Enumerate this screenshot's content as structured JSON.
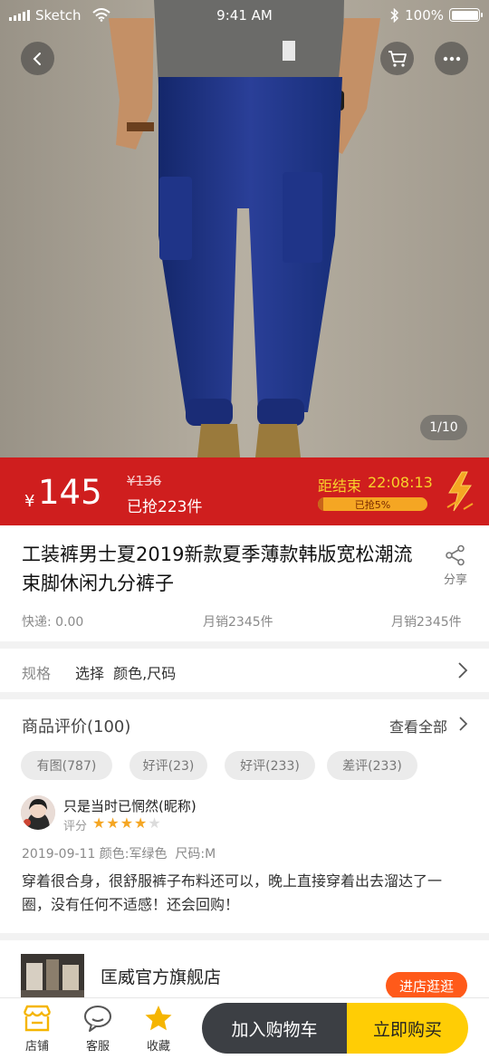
{
  "status_bar": {
    "carrier": "Sketch",
    "time": "9:41 AM",
    "battery": "100%"
  },
  "gallery": {
    "page_indicator": "1/10"
  },
  "price": {
    "currency": "¥",
    "current": "145",
    "original": "¥136",
    "sold": "已抢223件",
    "countdown_label": "距结束",
    "countdown_time": "22:08:13",
    "progress_label": "已抢5%",
    "progress_fraction": 0.05
  },
  "product": {
    "title": "工装裤男士夏2019新款夏季薄款韩版宽松潮流束脚休闲九分裤子",
    "share_label": "分享",
    "shipping": "快递: 0.00",
    "monthly_sales_1": "月销2345件",
    "monthly_sales_2": "月销2345件"
  },
  "spec": {
    "label": "规格",
    "value": "选择  颜色,尺码"
  },
  "reviews": {
    "title": "商品评价(100)",
    "view_all": "查看全部",
    "chips": [
      "有图(787)",
      "好评(23)",
      "好评(233)",
      "差评(233)"
    ],
    "reviewer": "只是当时已惘然(昵称)",
    "rating_label": "评分",
    "rating": 4,
    "rating_max": 5,
    "meta": "2019-09-11 颜色:军绿色  尺码:M",
    "text": "穿着很合身，很舒服裤子布料还可以，晚上直接穿着出去溜达了一圈，没有任何不适感！还会回购！"
  },
  "shop": {
    "name": "匡威官方旗舰店",
    "button": "进店逛逛"
  },
  "bottom_bar": {
    "tabs": [
      {
        "label": "店铺",
        "icon": "store-icon"
      },
      {
        "label": "客服",
        "icon": "chat-icon"
      },
      {
        "label": "收藏",
        "icon": "star-icon"
      }
    ],
    "add_to_cart": "加入购物车",
    "buy_now": "立即购买"
  },
  "colors": {
    "price_red": "#cf1e1e",
    "accent_yellow": "#ffcd05",
    "star": "#f5a623",
    "shop_button": "#ff5a1a"
  }
}
